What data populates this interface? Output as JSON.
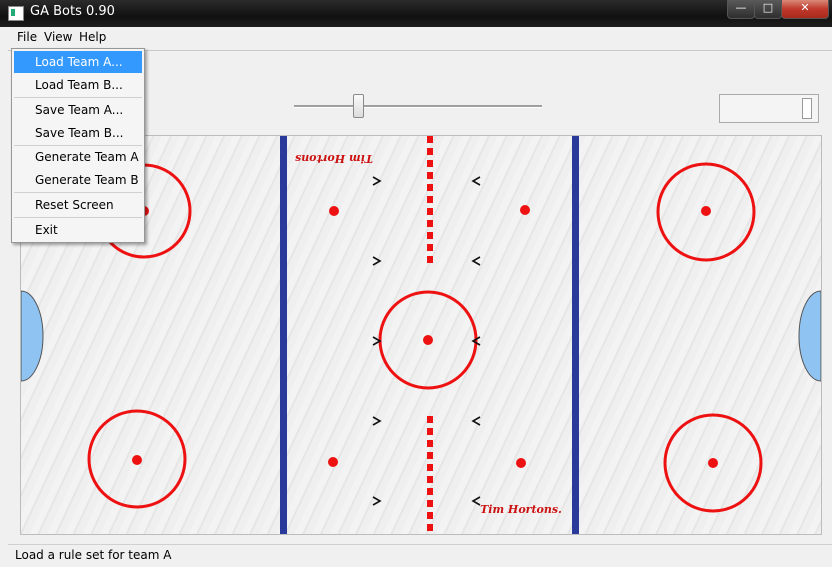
{
  "window": {
    "title": "GA Bots 0.90",
    "controls": {
      "minimize": "—",
      "maximize": "□",
      "close": "✕"
    }
  },
  "menubar": {
    "file": "File",
    "view": "View",
    "help": "Help"
  },
  "file_menu": {
    "items": [
      {
        "label": "Load Team A...",
        "highlighted": true
      },
      {
        "label": "Load Team B..."
      },
      {
        "label": "Save Team A..."
      },
      {
        "label": "Save Team B..."
      },
      {
        "label": "Generate Team A"
      },
      {
        "label": "Generate Team B"
      },
      {
        "label": "Reset Screen"
      },
      {
        "label": "Exit"
      }
    ]
  },
  "speed": {
    "slider_value": 0.26
  },
  "rink": {
    "logo_top": "Tim Hortons",
    "logo_bottom": "Tim Hortons.",
    "colors": {
      "red": "#ee1111",
      "blue": "#2a3a9a",
      "goal": "#8ec3f2"
    }
  },
  "status": {
    "text": "Load a rule set for team A"
  }
}
